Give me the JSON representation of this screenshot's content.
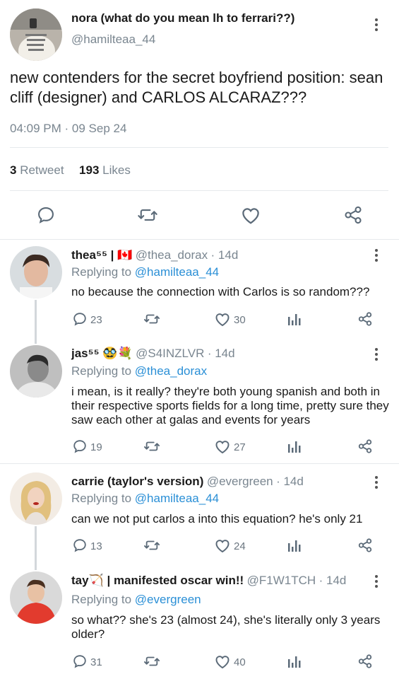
{
  "main_tweet": {
    "display_name": "nora (what do you mean lh to ferrari??)",
    "handle": "@hamilteaa_44",
    "text": "new contenders for the secret boyfriend position: sean cliff (designer) and CARLOS ALCARAZ???",
    "time": "04:09 PM",
    "date": "09 Sep 24",
    "retweet_count": "3",
    "retweet_label": "Retweet",
    "like_count": "193",
    "like_label": "Likes",
    "actions": [
      "comment-icon",
      "retweet-icon",
      "heart-icon",
      "share-icon"
    ]
  },
  "replies": [
    {
      "display_name": "thea⁵⁵ | 🇨🇦",
      "handle": "@thea_dorax",
      "age": "· 14d",
      "replying_prefix": "Replying to",
      "replying_to": "@hamilteaa_44",
      "text": "no because the connection with Carlos is so random???",
      "reply_count": "23",
      "like_count": "30"
    },
    {
      "display_name": "jas⁵⁵ 🥸💐",
      "handle": "@S4INZLVR",
      "age": "· 14d",
      "replying_prefix": "Replying to",
      "replying_to": "@thea_dorax",
      "text": "i mean, is it really? they're both young spanish and both in their respective sports fields for a long time, pretty sure they saw each other at galas and events for years",
      "reply_count": "19",
      "like_count": "27"
    },
    {
      "display_name": "carrie (taylor's version)",
      "handle": "@evergreen",
      "age": "· 14d",
      "replying_prefix": "Replying to",
      "replying_to": "@hamilteaa_44",
      "text": "can we not put carlos a into this equation? he's only 21",
      "reply_count": "13",
      "like_count": "24"
    },
    {
      "display_name": "tay🏹 | manifested oscar win!!",
      "handle": "@F1W1TCH",
      "age": "· 14d",
      "replying_prefix": "Replying to",
      "replying_to": "@evergreen",
      "text": "so what?? she's 23 (almost 24), she's literally only 3 years older?",
      "reply_count": "31",
      "like_count": "40"
    }
  ],
  "colors": {
    "link": "#2a8fd6",
    "icon": "#5b6a78",
    "muted": "#7a8690",
    "divider": "#e6e9ec"
  }
}
